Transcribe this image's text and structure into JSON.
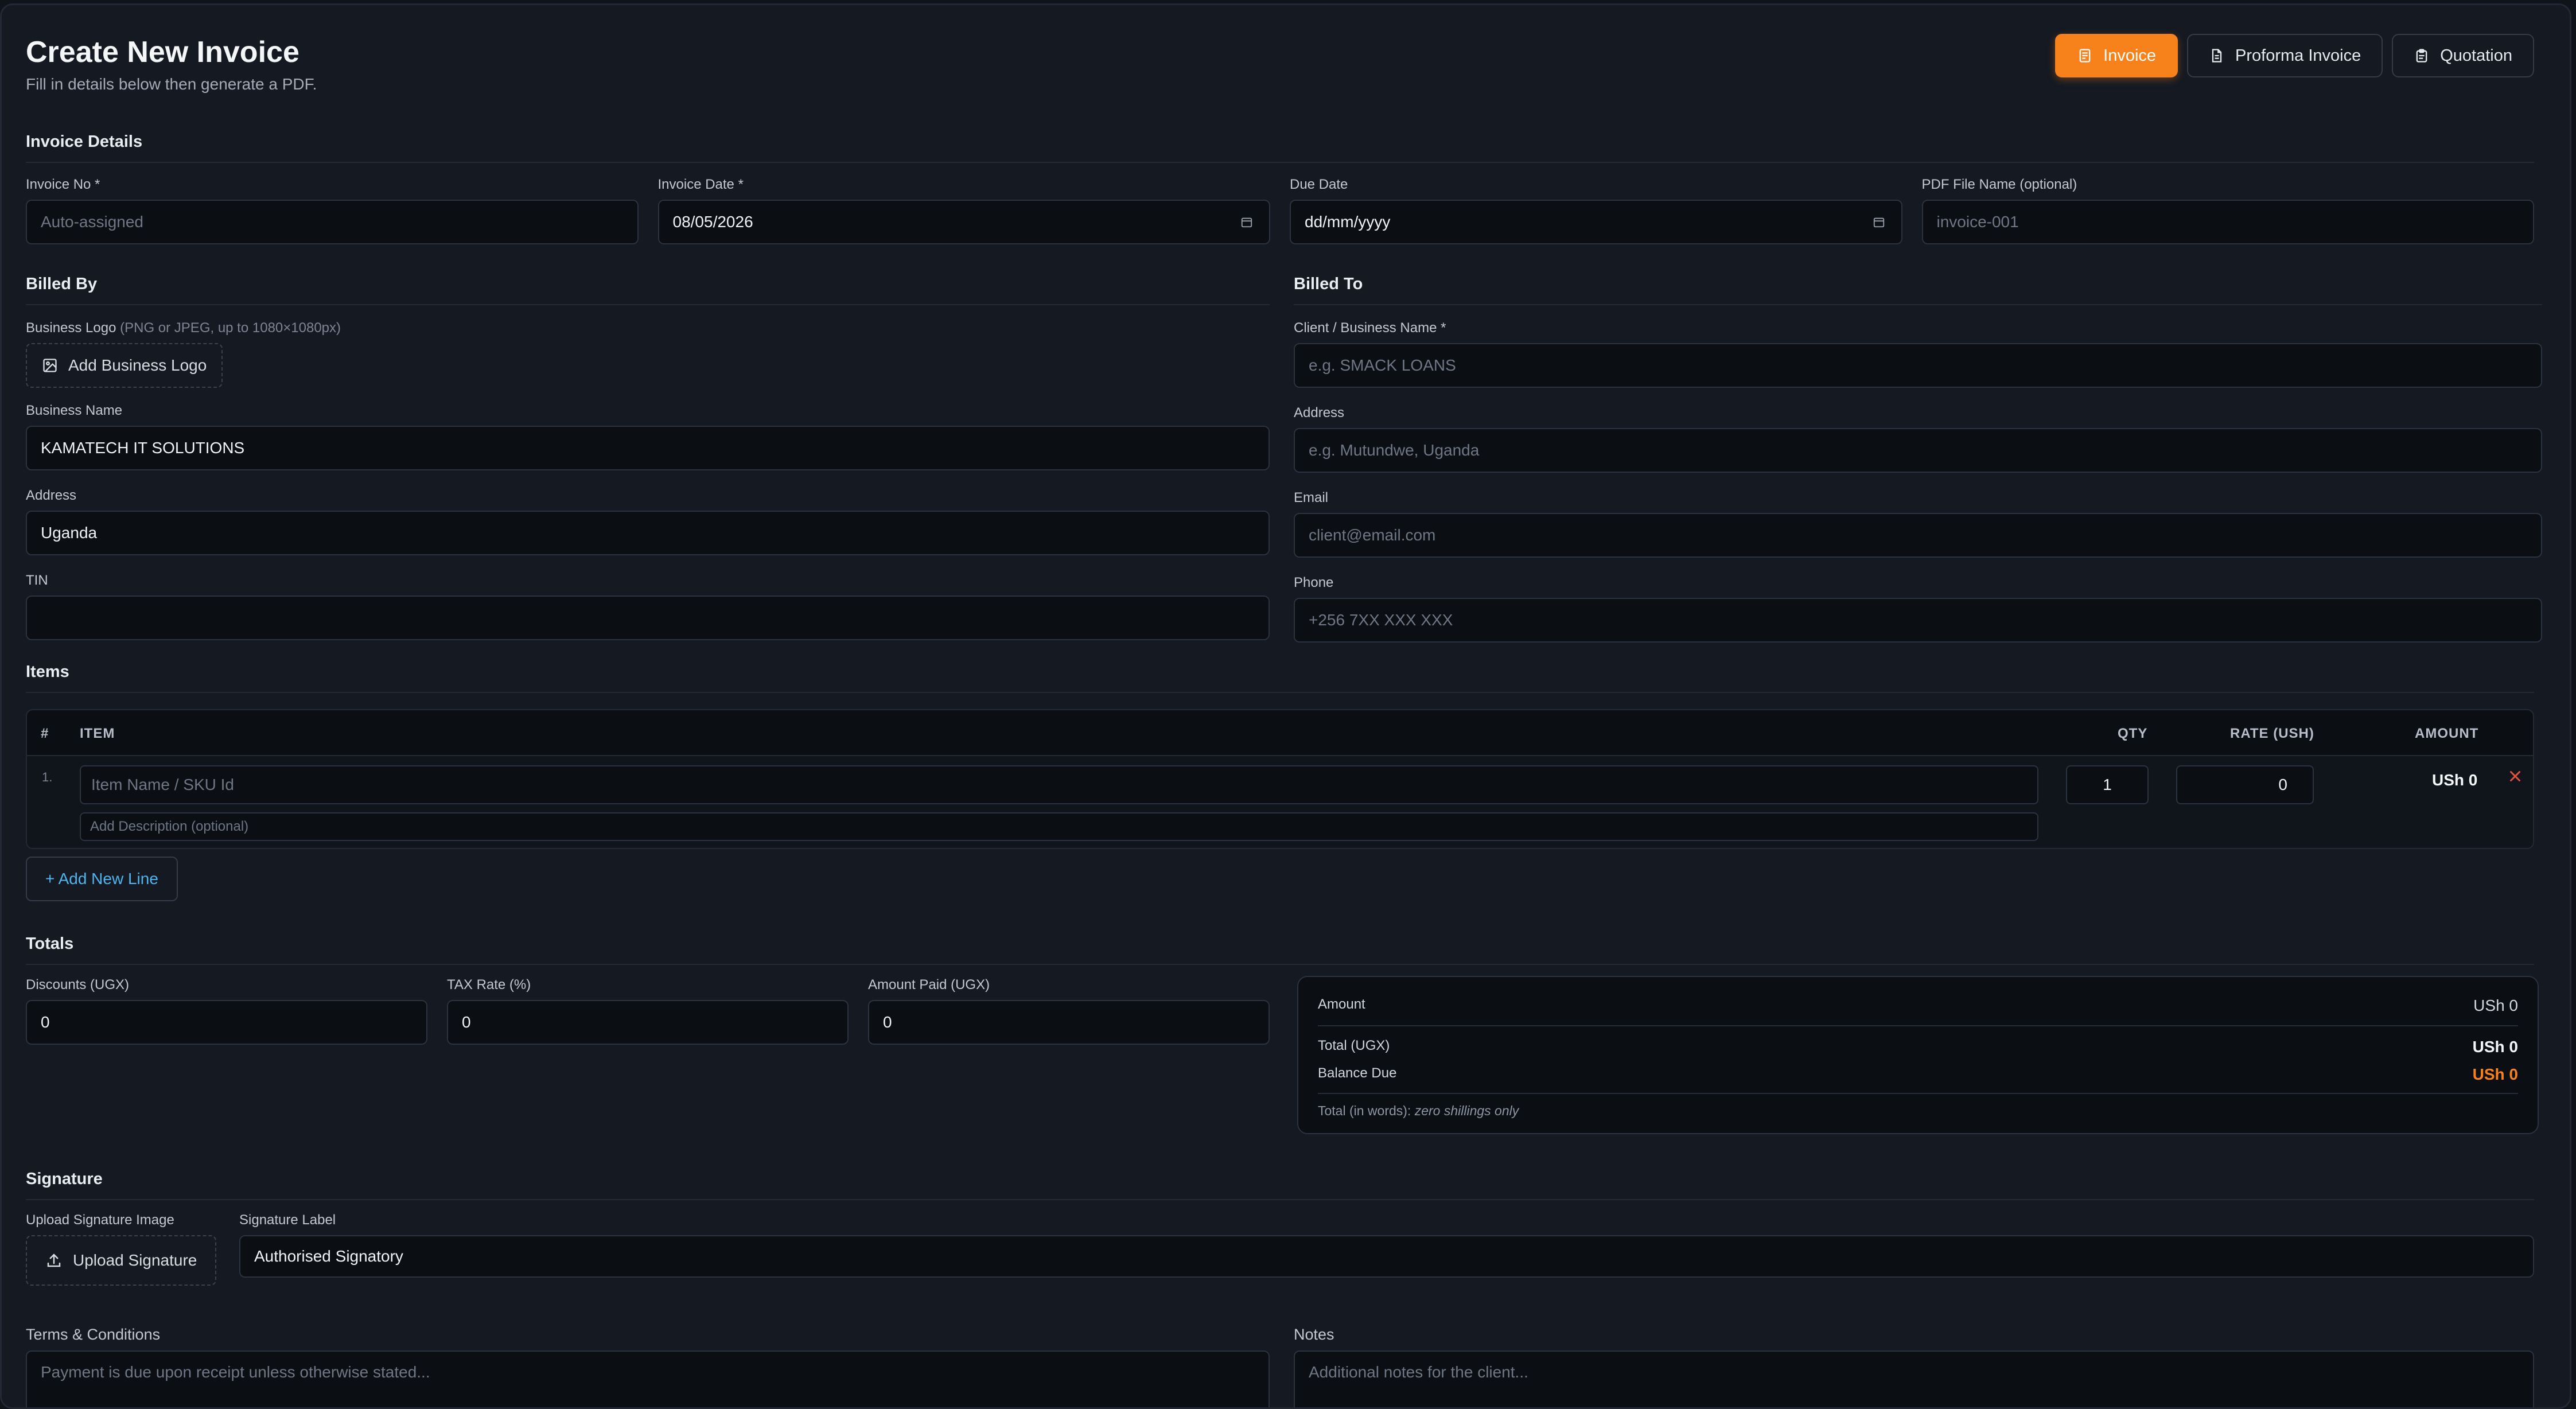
{
  "header": {
    "title": "Create New Invoice",
    "subtitle": "Fill in details below then generate a PDF."
  },
  "doc_types": [
    {
      "label": "Invoice",
      "active": true,
      "icon": "receipt-icon"
    },
    {
      "label": "Proforma Invoice",
      "active": false,
      "icon": "document-icon"
    },
    {
      "label": "Quotation",
      "active": false,
      "icon": "clipboard-icon"
    }
  ],
  "invoice_details": {
    "section_title": "Invoice Details",
    "invoice_no": {
      "label": "Invoice No *",
      "value": "",
      "placeholder": "Auto-assigned"
    },
    "invoice_date": {
      "label": "Invoice Date *",
      "value": "08/05/2026"
    },
    "due_date": {
      "label": "Due Date",
      "value": "dd/mm/yyyy"
    },
    "pdf_file_name": {
      "label": "PDF File Name (optional)",
      "value": "",
      "placeholder": "invoice-001"
    }
  },
  "billed_by": {
    "section_title": "Billed By",
    "logo_label": "Business Logo",
    "logo_hint": "(PNG or JPEG, up to 1080×1080px)",
    "logo_button": "Add Business Logo",
    "business_name": {
      "label": "Business Name",
      "value": "KAMATECH IT SOLUTIONS"
    },
    "address": {
      "label": "Address",
      "value": "Uganda"
    },
    "tin": {
      "label": "TIN",
      "value": ""
    }
  },
  "billed_to": {
    "section_title": "Billed To",
    "client_name": {
      "label": "Client / Business Name *",
      "placeholder": "e.g. SMACK LOANS"
    },
    "address": {
      "label": "Address",
      "placeholder": "e.g. Mutundwe, Uganda"
    },
    "email": {
      "label": "Email",
      "placeholder": "client@email.com"
    },
    "phone": {
      "label": "Phone",
      "placeholder": "+256 7XX XXX XXX"
    }
  },
  "items": {
    "section_title": "Items",
    "columns": {
      "num": "#",
      "item": "ITEM",
      "qty": "QTY",
      "rate": "RATE (USH)",
      "amount": "AMOUNT"
    },
    "rows": [
      {
        "num": "1.",
        "name_placeholder": "Item Name / SKU Id",
        "desc_placeholder": "Add Description (optional)",
        "qty": "1",
        "rate": "0",
        "amount": "USh 0"
      }
    ],
    "add_line": "+ Add New Line"
  },
  "totals": {
    "section_title": "Totals",
    "discounts": {
      "label": "Discounts (UGX)",
      "value": "0"
    },
    "tax_rate": {
      "label": "TAX Rate (%)",
      "value": "0"
    },
    "amount_paid": {
      "label": "Amount Paid (UGX)",
      "value": "0"
    },
    "summary": {
      "amount_label": "Amount",
      "amount_value": "USh 0",
      "total_label": "Total (UGX)",
      "total_value": "USh 0",
      "balance_label": "Balance Due",
      "balance_value": "USh 0",
      "words_label": "Total (in words):",
      "words_value": "zero shillings only"
    }
  },
  "signature": {
    "section_title": "Signature",
    "upload_label": "Upload Signature Image",
    "upload_button": "Upload Signature",
    "sig_label": {
      "label": "Signature Label",
      "value": "Authorised Signatory"
    }
  },
  "terms": {
    "label": "Terms & Conditions",
    "placeholder": "Payment is due upon receipt unless otherwise stated..."
  },
  "notes": {
    "label": "Notes",
    "placeholder": "Additional notes for the client..."
  },
  "colors": {
    "accent": "#f7821b",
    "link": "#4fb5ef",
    "remove": "#e2533f",
    "background": "#141922"
  }
}
